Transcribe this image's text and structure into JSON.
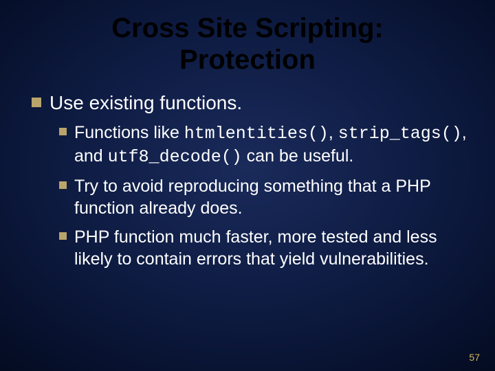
{
  "title_line1": "Cross Site Scripting:",
  "title_line2": "Protection",
  "bullets": {
    "main": "Use existing functions.",
    "sub1_a": "Functions like ",
    "sub1_fn1": "htmlentities()",
    "sub1_b": ", ",
    "sub1_fn2": "strip_tags()",
    "sub1_c": ", and ",
    "sub1_fn3": "utf8_decode()",
    "sub1_d": " can be useful.",
    "sub2": "Try to avoid reproducing something that a PHP function already does.",
    "sub3": "PHP function much faster, more tested and less likely to contain errors that yield vulnerabilities."
  },
  "page_number": "57"
}
